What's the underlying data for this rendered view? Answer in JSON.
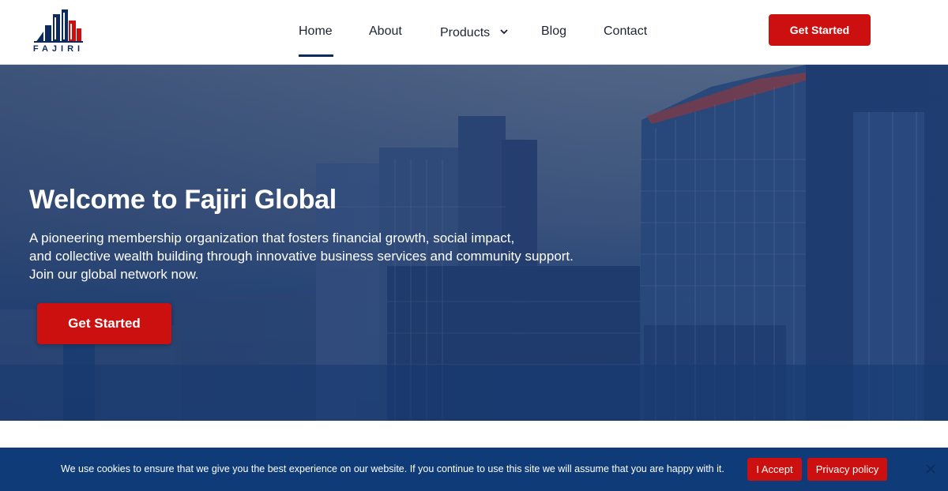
{
  "brand": {
    "name": "FAJIRI",
    "colors": {
      "navy": "#0d2a5c",
      "red": "#cc0f0f",
      "cookie_bg": "#0f3b79"
    }
  },
  "nav": {
    "items": [
      {
        "label": "Home",
        "active": true
      },
      {
        "label": "About"
      },
      {
        "label": "Products",
        "icon": "chevron-down-icon"
      },
      {
        "label": "Blog"
      },
      {
        "label": "Contact"
      }
    ],
    "cta_label": "Get Started"
  },
  "hero": {
    "title": "Welcome to Fajiri Global",
    "subtitle_lines": [
      "A pioneering membership organization that fosters financial growth, social impact,",
      "and collective wealth building through innovative business services and community support.",
      "Join our global network now."
    ],
    "cta_label": "Get Started"
  },
  "cookie": {
    "message": "We use cookies to ensure that we give you the best experience on our website. If you continue to use this site we will assume that you are happy with it.",
    "accept_label": "I Accept",
    "privacy_label": "Privacy policy",
    "close_icon": "close-icon"
  }
}
